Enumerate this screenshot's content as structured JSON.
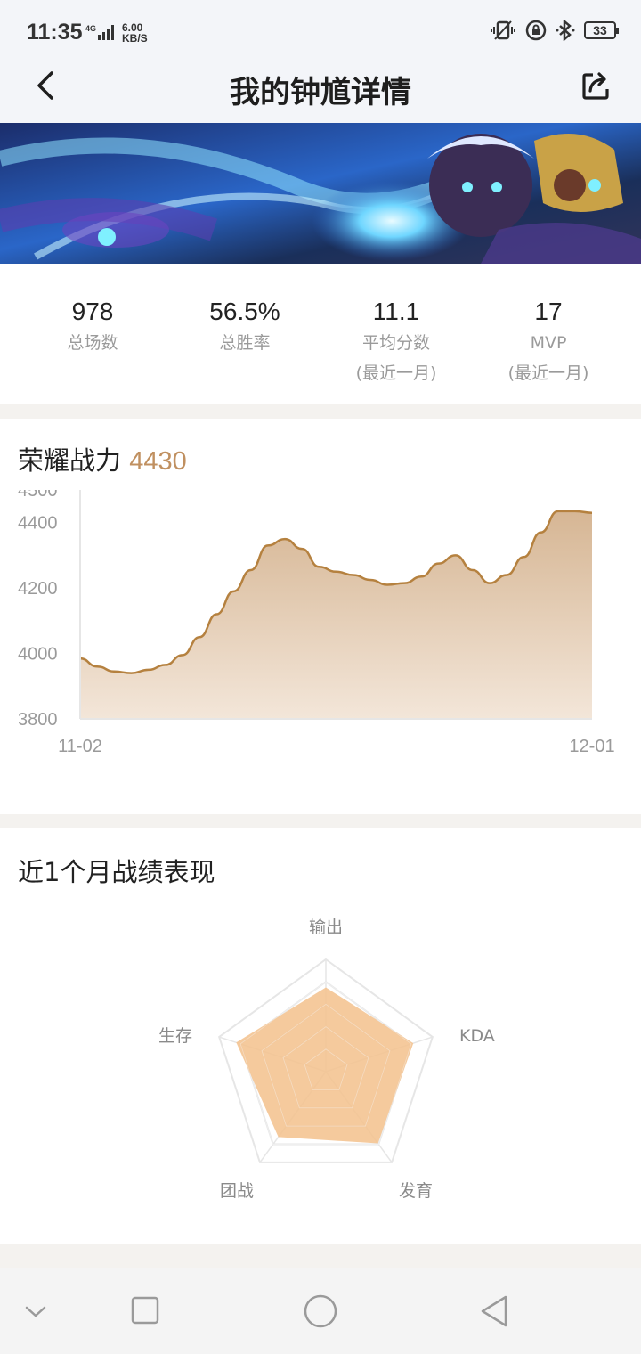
{
  "status_bar": {
    "time": "11:35",
    "network": "4G",
    "speed_value": "6.00",
    "speed_unit": "KB/S",
    "battery": "33"
  },
  "header": {
    "title": "我的钟馗详情"
  },
  "stats": [
    {
      "value": "978",
      "label": "总场数",
      "sub": ""
    },
    {
      "value": "56.5%",
      "label": "总胜率",
      "sub": ""
    },
    {
      "value": "11.1",
      "label": "平均分数",
      "sub": "(最近一月)"
    },
    {
      "value": "17",
      "label": "MVP",
      "sub": "(最近一月)"
    }
  ],
  "power_card": {
    "title": "荣耀战力",
    "value": "4430"
  },
  "chart_data": {
    "type": "area",
    "x_start": "11-02",
    "x_end": "12-01",
    "yticks": [
      4500,
      4400,
      4200,
      4000,
      3800
    ],
    "ylim": [
      3800,
      4500
    ],
    "values": [
      3985,
      3960,
      3945,
      3940,
      3950,
      3965,
      3995,
      4050,
      4120,
      4190,
      4255,
      4330,
      4350,
      4320,
      4265,
      4250,
      4240,
      4225,
      4210,
      4215,
      4235,
      4275,
      4300,
      4255,
      4215,
      4240,
      4295,
      4370,
      4435,
      4435,
      4430
    ],
    "fill_top": "#d6b694",
    "line": "#b5813f"
  },
  "radar_card": {
    "title": "近1个月战绩表现"
  },
  "radar": {
    "labels": [
      "输出",
      "KDA",
      "发育",
      "团战",
      "生存"
    ],
    "values": [
      0.75,
      0.82,
      0.79,
      0.72,
      0.84
    ],
    "fill": "#f3c18c"
  },
  "system_nav": {
    "icons": [
      "chevron-down-icon",
      "recents-icon",
      "home-icon",
      "back-icon"
    ]
  }
}
